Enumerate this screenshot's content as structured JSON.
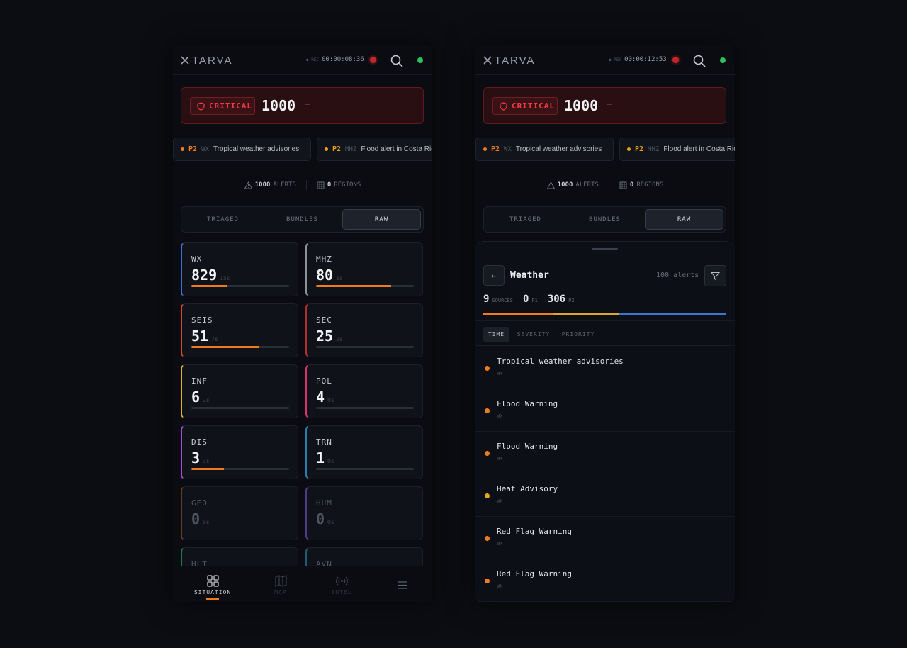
{
  "brand": "TARVA",
  "colors": {
    "critical": "#ef3b44",
    "p2": "#f07b1c",
    "online": "#2ec25a",
    "accent": "#f07b1c"
  },
  "screens": [
    {
      "rec_tag": "● REC",
      "timer": "00:00:08:36"
    },
    {
      "rec_tag": "● REC",
      "timer": "00:00:12:53"
    }
  ],
  "critical": {
    "label": "CRITICAL",
    "count": "1000",
    "dash": "—"
  },
  "ticker": [
    {
      "priority": "P2",
      "source": "WX",
      "title": "Tropical weather advisories",
      "color": "#f07b1c"
    },
    {
      "priority": "P2",
      "source": "MHZ",
      "title": "Flood alert in Costa Rica",
      "color": "#e8a21c"
    }
  ],
  "stats": {
    "alerts_count": "1000",
    "alerts_label": "ALERTS",
    "regions_count": "0",
    "regions_label": "REGIONS"
  },
  "tabs": [
    {
      "label": "TRIAGED"
    },
    {
      "label": "BUNDLES"
    },
    {
      "label": "RAW",
      "active": true
    }
  ],
  "categories": [
    {
      "code": "WX",
      "count": "829",
      "rate": "15s",
      "fill": 0.37,
      "color": "#3f6fd9"
    },
    {
      "code": "MHZ",
      "count": "80",
      "rate": "1s",
      "fill": 0.77,
      "color": "#8c919b"
    },
    {
      "code": "SEIS",
      "count": "51",
      "rate": "7s",
      "fill": 0.69,
      "color": "#d8462a"
    },
    {
      "code": "SEC",
      "count": "25",
      "rate": "2s",
      "fill": 0.0,
      "color": "#b43030"
    },
    {
      "code": "INF",
      "count": "6",
      "rate": "2s",
      "fill": 0.0,
      "color": "#e0b228"
    },
    {
      "code": "POL",
      "count": "4",
      "rate": "0s",
      "fill": 0.0,
      "color": "#d8336c"
    },
    {
      "code": "DIS",
      "count": "3",
      "rate": "3s",
      "fill": 0.33,
      "color": "#a64ad8"
    },
    {
      "code": "TRN",
      "count": "1",
      "rate": "0s",
      "fill": 0.0,
      "color": "#2a7fb0"
    },
    {
      "code": "GEO",
      "count": "0",
      "rate": "0s",
      "fill": 0.0,
      "color": "#6b3a1c"
    },
    {
      "code": "HUM",
      "count": "0",
      "rate": "0s",
      "fill": 0.0,
      "color": "#4b3c86"
    },
    {
      "code": "HLT",
      "count": "",
      "rate": "",
      "fill": 0.0,
      "color": "#1f7a45"
    },
    {
      "code": "AVN",
      "count": "",
      "rate": "",
      "fill": 0.0,
      "color": "#255a73"
    }
  ],
  "bottom_nav": [
    {
      "label": "SITUATION",
      "icon": "grid-icon",
      "active": true
    },
    {
      "label": "MAP",
      "icon": "map-icon"
    },
    {
      "label": "INTEL",
      "icon": "broadcast-icon"
    },
    {
      "label": "",
      "icon": "menu-icon"
    }
  ],
  "sheet": {
    "back": "←",
    "title": "Weather",
    "alert_count": "100 alerts",
    "sources_count": "9",
    "sources_label": "SOURCES",
    "p1_count": "0",
    "p1_label": "P1",
    "p2_count": "306",
    "p2_label": "P2",
    "distribution": [
      {
        "share": 0.29,
        "color": "#f07b1c"
      },
      {
        "share": 0.27,
        "color": "#e2a52b"
      },
      {
        "share": 0.44,
        "color": "#3d74d8"
      }
    ],
    "sort_options": [
      {
        "label": "TIME",
        "active": true
      },
      {
        "label": "SEVERITY"
      },
      {
        "label": "PRIORITY"
      }
    ],
    "alerts": [
      {
        "title": "Tropical weather advisories",
        "source": "WX",
        "color": "#f07b1c"
      },
      {
        "title": "Flood Warning",
        "source": "WX",
        "color": "#f07b1c"
      },
      {
        "title": "Flood Warning",
        "source": "WX",
        "color": "#f07b1c"
      },
      {
        "title": "Heat Advisory",
        "source": "WX",
        "color": "#e2a52b"
      },
      {
        "title": "Red Flag Warning",
        "source": "WX",
        "color": "#f07b1c"
      },
      {
        "title": "Red Flag Warning",
        "source": "WX",
        "color": "#f07b1c"
      }
    ]
  }
}
